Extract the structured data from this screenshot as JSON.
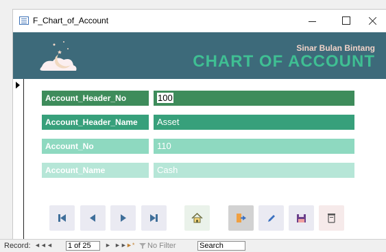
{
  "window": {
    "title": "F_Chart_of_Account"
  },
  "header": {
    "brand": "Sinar Bulan Bintang",
    "title": "CHART OF ACCOUNT"
  },
  "form": {
    "fields": [
      {
        "label": "Account_Header_No",
        "value": "100"
      },
      {
        "label": "Account_Header_Name",
        "value": "Asset"
      },
      {
        "label": "Account_No",
        "value": "110"
      },
      {
        "label": "Account_Name",
        "value": "Cash"
      }
    ]
  },
  "toolbar": {
    "icons": [
      "first-record-icon",
      "previous-record-icon",
      "next-record-icon",
      "last-record-icon",
      "home-icon",
      "exit-icon",
      "edit-icon",
      "save-icon",
      "delete-icon"
    ]
  },
  "statusbar": {
    "label": "Record:",
    "first": "◄◄",
    "prev": "◄",
    "position": "1 of 25",
    "next": "►",
    "last": "►►",
    "new": "►*",
    "filter": "No Filter",
    "search_value": "Search"
  },
  "colors": {
    "header": "#3d6a7a",
    "accent": "#3fbf93",
    "row1": "#3e8c5b",
    "row2": "#37a07b",
    "row3": "#8ed9c0",
    "row4": "#b6e6d7"
  }
}
